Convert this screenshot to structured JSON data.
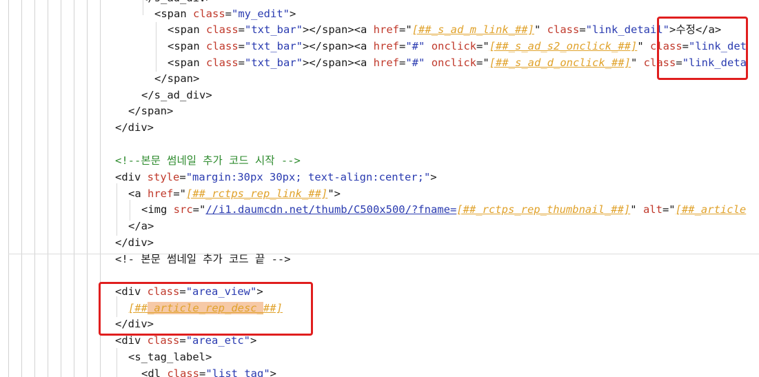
{
  "lines": [
    {
      "id": "l0",
      "tokens": [
        {
          "c": "t",
          "s": "</s_ad_div>"
        }
      ]
    },
    {
      "id": "l1",
      "tokens": [
        {
          "c": "t",
          "s": "<span "
        },
        {
          "c": "at",
          "s": "class"
        },
        {
          "c": "t",
          "s": "="
        },
        {
          "c": "v",
          "s": "\"my_edit\""
        },
        {
          "c": "t",
          "s": ">"
        }
      ]
    },
    {
      "id": "l2",
      "tokens": [
        {
          "c": "t",
          "s": "<span "
        },
        {
          "c": "at",
          "s": "class"
        },
        {
          "c": "t",
          "s": "="
        },
        {
          "c": "v",
          "s": "\"txt_bar\""
        },
        {
          "c": "t",
          "s": "></span><a "
        },
        {
          "c": "at",
          "s": "href"
        },
        {
          "c": "t",
          "s": "=\""
        },
        {
          "c": "tp",
          "s": "[##_s_ad_m_link_##]"
        },
        {
          "c": "t",
          "s": "\" "
        },
        {
          "c": "at",
          "s": "class"
        },
        {
          "c": "t",
          "s": "="
        },
        {
          "c": "v",
          "s": "\"link_detail\""
        },
        {
          "c": "t",
          "s": ">수정</a>"
        }
      ]
    },
    {
      "id": "l3",
      "tokens": [
        {
          "c": "t",
          "s": "<span "
        },
        {
          "c": "at",
          "s": "class"
        },
        {
          "c": "t",
          "s": "="
        },
        {
          "c": "v",
          "s": "\"txt_bar\""
        },
        {
          "c": "t",
          "s": "></span><a "
        },
        {
          "c": "at",
          "s": "href"
        },
        {
          "c": "t",
          "s": "="
        },
        {
          "c": "v",
          "s": "\"#\""
        },
        {
          "c": "t",
          "s": " "
        },
        {
          "c": "at",
          "s": "onclick"
        },
        {
          "c": "t",
          "s": "=\""
        },
        {
          "c": "tp",
          "s": "[##_s_ad_s2_onclick_##]"
        },
        {
          "c": "t",
          "s": "\" "
        },
        {
          "c": "at",
          "s": "class"
        },
        {
          "c": "t",
          "s": "="
        },
        {
          "c": "v",
          "s": "\"link_det"
        }
      ]
    },
    {
      "id": "l4",
      "tokens": [
        {
          "c": "t",
          "s": "<span "
        },
        {
          "c": "at",
          "s": "class"
        },
        {
          "c": "t",
          "s": "="
        },
        {
          "c": "v",
          "s": "\"txt_bar\""
        },
        {
          "c": "t",
          "s": "></span><a "
        },
        {
          "c": "at",
          "s": "href"
        },
        {
          "c": "t",
          "s": "="
        },
        {
          "c": "v",
          "s": "\"#\""
        },
        {
          "c": "t",
          "s": " "
        },
        {
          "c": "at",
          "s": "onclick"
        },
        {
          "c": "t",
          "s": "=\""
        },
        {
          "c": "tp",
          "s": "[##_s_ad_d_onclick_##]"
        },
        {
          "c": "t",
          "s": "\" "
        },
        {
          "c": "at",
          "s": "class"
        },
        {
          "c": "t",
          "s": "="
        },
        {
          "c": "v",
          "s": "\"link_deta"
        }
      ]
    },
    {
      "id": "l5",
      "tokens": [
        {
          "c": "t",
          "s": "</span>"
        }
      ]
    },
    {
      "id": "l6",
      "tokens": [
        {
          "c": "t",
          "s": "</s_ad_div>"
        }
      ]
    },
    {
      "id": "l7",
      "tokens": [
        {
          "c": "t",
          "s": "</span>"
        }
      ]
    },
    {
      "id": "l8",
      "tokens": [
        {
          "c": "t",
          "s": "</div>"
        }
      ]
    },
    {
      "id": "l9",
      "tokens": []
    },
    {
      "id": "l10",
      "tokens": [
        {
          "c": "cm",
          "s": "<!--본문 썸네일 추가 코드 시작 -->"
        }
      ]
    },
    {
      "id": "l11",
      "tokens": [
        {
          "c": "t",
          "s": "<div "
        },
        {
          "c": "at",
          "s": "style"
        },
        {
          "c": "t",
          "s": "="
        },
        {
          "c": "v",
          "s": "\"margin:30px 30px; text-align:center;\""
        },
        {
          "c": "t",
          "s": ">"
        }
      ]
    },
    {
      "id": "l12",
      "tokens": [
        {
          "c": "t",
          "s": "<a "
        },
        {
          "c": "at",
          "s": "href"
        },
        {
          "c": "t",
          "s": "=\""
        },
        {
          "c": "tp",
          "s": "[##_rctps_rep_link_##]"
        },
        {
          "c": "t",
          "s": "\">"
        }
      ]
    },
    {
      "id": "l13",
      "tokens": [
        {
          "c": "t",
          "s": "<img "
        },
        {
          "c": "at",
          "s": "src"
        },
        {
          "c": "t",
          "s": "=\""
        },
        {
          "c": "url",
          "s": "//i1.daumcdn.net/thumb/C500x500/?fname="
        },
        {
          "c": "tp",
          "s": "[##_rctps_rep_thumbnail_##]"
        },
        {
          "c": "t",
          "s": "\" "
        },
        {
          "c": "at",
          "s": "alt"
        },
        {
          "c": "t",
          "s": "=\""
        },
        {
          "c": "tp",
          "s": "[##_article"
        }
      ]
    },
    {
      "id": "l14",
      "tokens": [
        {
          "c": "t",
          "s": "</a>"
        }
      ]
    },
    {
      "id": "l15",
      "tokens": [
        {
          "c": "t",
          "s": "</div>"
        }
      ]
    },
    {
      "id": "l16",
      "tokens": [
        {
          "c": "cm2",
          "s": "<!- 본문 썸네일 추가 코드 끝 -->"
        }
      ]
    },
    {
      "id": "l17",
      "tokens": []
    },
    {
      "id": "l18",
      "tokens": [
        {
          "c": "t",
          "s": "<div "
        },
        {
          "c": "at",
          "s": "class"
        },
        {
          "c": "t",
          "s": "="
        },
        {
          "c": "v",
          "s": "\"area_view\""
        },
        {
          "c": "t",
          "s": ">"
        }
      ]
    },
    {
      "id": "l19",
      "tokens": [
        {
          "c": "tp",
          "s": "[##"
        },
        {
          "c": "tp hl",
          "s": "_article_rep_desc_"
        },
        {
          "c": "tp",
          "s": "##]"
        }
      ]
    },
    {
      "id": "l20",
      "tokens": [
        {
          "c": "t",
          "s": "</div>"
        }
      ]
    },
    {
      "id": "l21",
      "tokens": [
        {
          "c": "t",
          "s": "<div "
        },
        {
          "c": "at",
          "s": "class"
        },
        {
          "c": "t",
          "s": "="
        },
        {
          "c": "v",
          "s": "\"area_etc\""
        },
        {
          "c": "t",
          "s": ">"
        }
      ]
    },
    {
      "id": "l22",
      "tokens": [
        {
          "c": "t",
          "s": "<s_tag_label>"
        }
      ]
    },
    {
      "id": "l23",
      "tokens": [
        {
          "c": "t",
          "s": "<dl "
        },
        {
          "c": "at",
          "s": "class"
        },
        {
          "c": "t",
          "s": "="
        },
        {
          "c": "v",
          "s": "\"list_tag\""
        },
        {
          "c": "t",
          "s": ">"
        }
      ]
    }
  ]
}
